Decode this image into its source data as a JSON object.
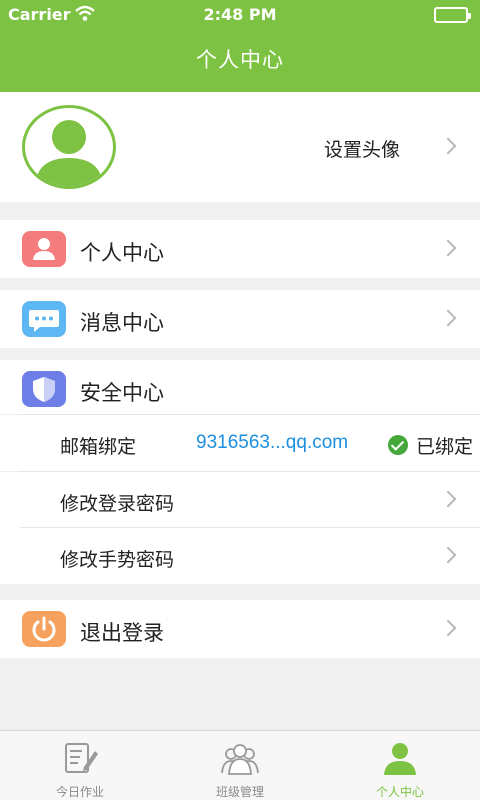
{
  "status_bar": {
    "carrier": "Carrier",
    "time": "2:48 PM"
  },
  "nav": {
    "title": "个人中心"
  },
  "avatar_row": {
    "label": "设置头像",
    "icon": "user-avatar-icon"
  },
  "menu": {
    "personal": {
      "label": "个人中心",
      "icon": "person-icon",
      "color": "#f47c7c"
    },
    "messages": {
      "label": "消息中心",
      "icon": "chat-icon",
      "color": "#5cb7f2"
    },
    "security": {
      "label": "安全中心",
      "icon": "shield-icon",
      "color": "#6d7fe6"
    },
    "logout": {
      "label": "退出登录",
      "icon": "power-icon",
      "color": "#f6a25e"
    }
  },
  "security": {
    "email_label": "邮箱绑定",
    "email_value": "9316563...qq.com",
    "email_status": "已绑定",
    "change_login_password": "修改登录密码",
    "change_gesture_password": "修改手势密码"
  },
  "tabs": [
    {
      "label": "今日作业",
      "icon": "homework-icon",
      "active": false
    },
    {
      "label": "班级管理",
      "icon": "class-group-icon",
      "active": false
    },
    {
      "label": "个人中心",
      "icon": "person-tab-icon",
      "active": true
    }
  ],
  "colors": {
    "brand": "#7dc242",
    "link": "#1c8fe0"
  }
}
